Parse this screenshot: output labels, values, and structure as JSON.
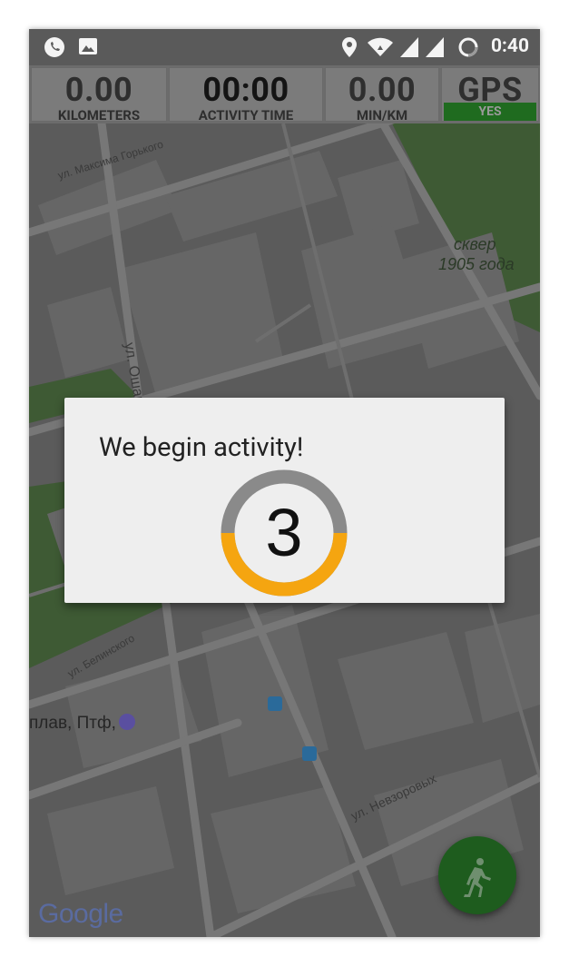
{
  "status_bar": {
    "time": "0:40",
    "left_icons": [
      "phone-call-icon",
      "image-icon"
    ],
    "right_icons": [
      "location-pin-icon",
      "wifi-icon",
      "signal-icon",
      "signal-icon-2",
      "loading-circle-icon"
    ]
  },
  "stats": {
    "distance": {
      "value": "0.00",
      "label": "KILOMETERS"
    },
    "time": {
      "value": "00:00",
      "label": "ACTIVITY TIME"
    },
    "pace": {
      "value": "0.00",
      "label": "MIN/KM"
    },
    "gps": {
      "value": "GPS",
      "status": "YES"
    }
  },
  "map": {
    "labels": {
      "street1": "ул. Максима Горького",
      "street2": "ул. Ошар",
      "square_line1": "сквер",
      "square_line2": "1905 года",
      "street3": "ул. Белинского",
      "place": "плав, Птф,",
      "street4": "ул. Невзоровых"
    },
    "attribution": "Google"
  },
  "dialog": {
    "title": "We begin activity!",
    "countdown": "3"
  },
  "colors": {
    "accent_orange": "#f5a510",
    "ring_gray": "#8a8a8a",
    "fab_green": "#1e5c1e",
    "gps_green": "#1f6b1f"
  },
  "fab": {
    "icon": "running-person-icon"
  }
}
